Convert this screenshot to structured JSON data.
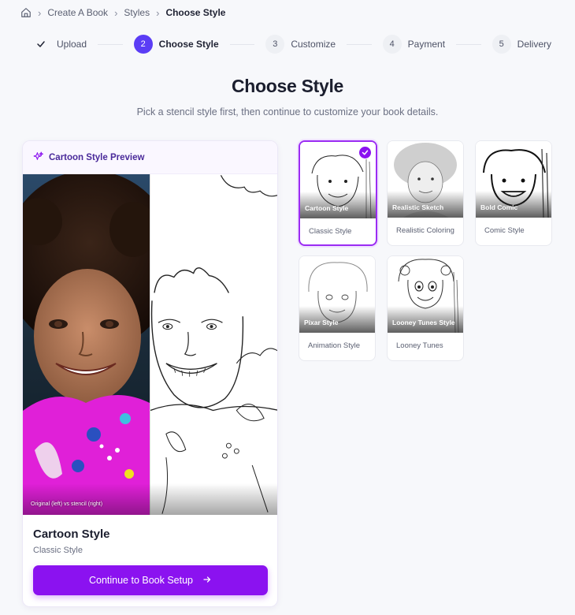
{
  "breadcrumb": {
    "home_icon": "home-icon",
    "items": [
      "Create A Book",
      "Styles",
      "Choose Style"
    ]
  },
  "stepper": {
    "steps": [
      {
        "number": "",
        "label": "Upload",
        "state": "done"
      },
      {
        "number": "2",
        "label": "Choose Style",
        "state": "active"
      },
      {
        "number": "3",
        "label": "Customize",
        "state": "pending"
      },
      {
        "number": "4",
        "label": "Payment",
        "state": "pending"
      },
      {
        "number": "5",
        "label": "Delivery",
        "state": "pending"
      }
    ]
  },
  "page": {
    "title": "Choose Style",
    "subtitle": "Pick a stencil style first, then continue to customize your book details."
  },
  "preview": {
    "header": "Cartoon Style Preview",
    "caption": "Original (left) vs stencil (right)",
    "style_name": "Cartoon Style",
    "style_sub": "Classic Style",
    "continue_label": "Continue to Book Setup"
  },
  "styles": [
    {
      "name": "Cartoon Style",
      "desc": "Classic Style",
      "selected": true
    },
    {
      "name": "Realistic Sketch",
      "desc": "Realistic Coloring",
      "selected": false
    },
    {
      "name": "Bold Comic",
      "desc": "Comic Style",
      "selected": false
    },
    {
      "name": "Pixar Style",
      "desc": "Animation Style",
      "selected": false
    },
    {
      "name": "Looney Tunes Style",
      "desc": "Looney Tunes",
      "selected": false
    }
  ],
  "colors": {
    "accent": "#8b12f0",
    "step_active": "#5b3df5"
  }
}
